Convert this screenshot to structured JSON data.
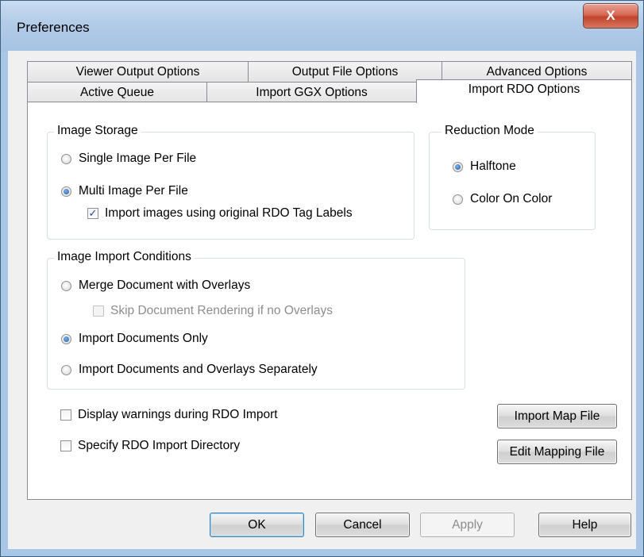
{
  "window": {
    "title": "Preferences",
    "close_label": "X"
  },
  "tabs": {
    "row_back": [
      "Viewer Output Options",
      "Output File Options",
      "Advanced Options"
    ],
    "row_front": [
      "Active Queue",
      "Import GGX Options",
      "Import RDO Options"
    ],
    "active": "Import RDO Options"
  },
  "image_storage": {
    "title": "Image Storage",
    "single_label": "Single Image Per File",
    "multi_label": "Multi Image Per File",
    "tag_labels_label": "Import images using original RDO Tag Labels",
    "selected": "multi",
    "tag_labels_checked": true
  },
  "reduction_mode": {
    "title": "Reduction Mode",
    "halftone_label": "Halftone",
    "color_label": "Color On Color",
    "selected": "halftone"
  },
  "import_conditions": {
    "title": "Image Import Conditions",
    "merge_label": "Merge Document with Overlays",
    "skip_label": "Skip Document Rendering if no Overlays",
    "docs_only_label": "Import Documents Only",
    "separately_label": "Import Documents and Overlays Separately",
    "selected": "docs_only"
  },
  "options": {
    "warnings_label": "Display warnings during RDO Import",
    "directory_label": "Specify RDO Import Directory"
  },
  "buttons": {
    "import_map": "Import Map File",
    "edit_mapping": "Edit Mapping File",
    "ok": "OK",
    "cancel": "Cancel",
    "apply": "Apply",
    "help": "Help"
  }
}
